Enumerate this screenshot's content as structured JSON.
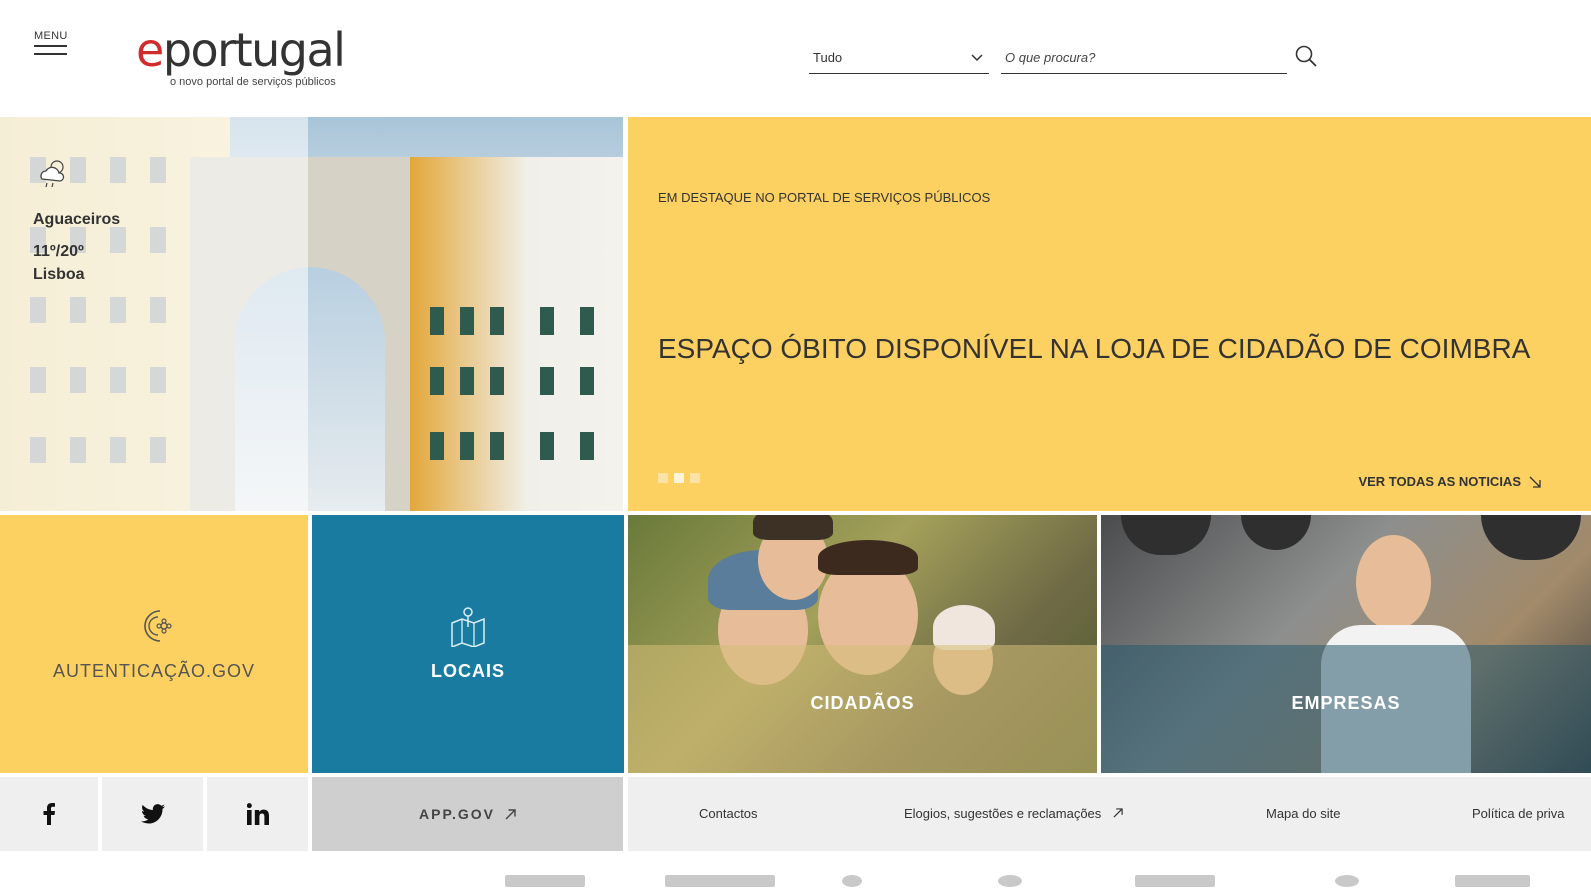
{
  "header": {
    "menu_label": "MENU",
    "logo_e": "e",
    "logo_word": "portugal",
    "logo_tagline": "o novo portal de serviços públicos",
    "search_scope": "Tudo",
    "search_placeholder": "O que procura?"
  },
  "weather": {
    "description": "Aguaceiros",
    "temperature": "11º/20º",
    "city": "Lisboa",
    "icon": "cloud-rain-sun-icon"
  },
  "news": {
    "kicker": "EM DESTAQUE NO PORTAL DE SERVIÇOS PÚBLICOS",
    "headline": "ESPAÇO ÓBITO DISPONÍVEL NA LOJA DE CIDADÃO DE COIMBRA",
    "see_all": "VER TODAS AS NOTICIAS",
    "slides": 3,
    "active_slide": 2
  },
  "tiles": {
    "auth": "AUTENTICAÇÃO.GOV",
    "locais": "LOCAIS",
    "cidadaos": "CIDADÃOS",
    "empresas": "EMPRESAS"
  },
  "footer": {
    "app_gov": "APP.GOV",
    "links": [
      "Contactos",
      "Elogios, sugestões e reclamações",
      "Mapa do site",
      "Política de priva"
    ]
  },
  "colors": {
    "accent_yellow": "#fdd161",
    "accent_blue": "#1a7ba0",
    "logo_red": "#d12b2b"
  }
}
